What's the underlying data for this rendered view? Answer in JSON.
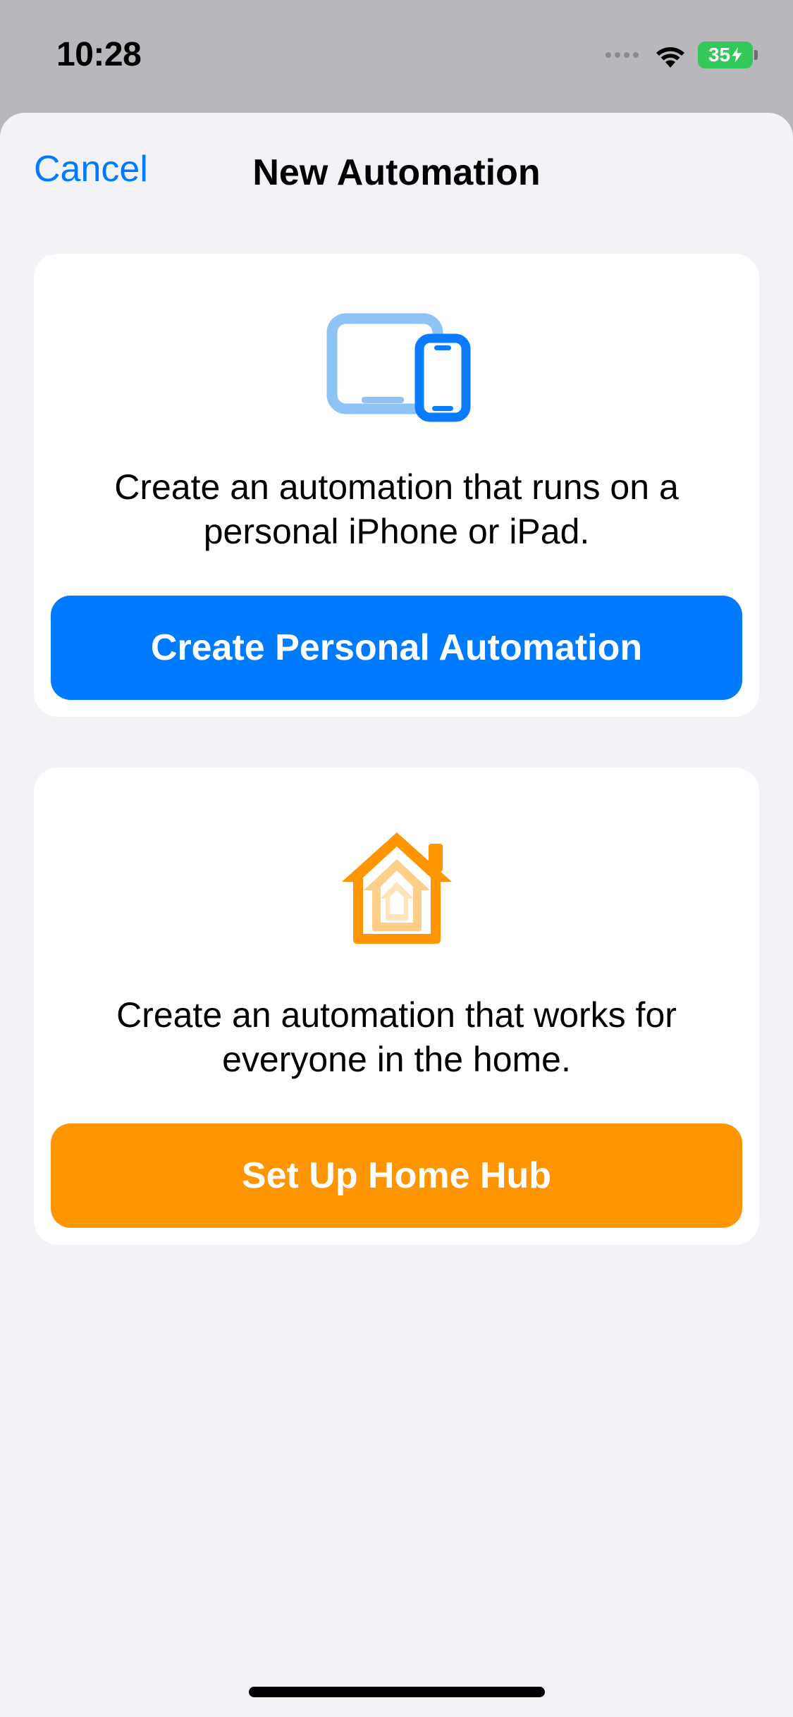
{
  "statusBar": {
    "time": "10:28",
    "batteryLabel": "35"
  },
  "nav": {
    "cancel": "Cancel",
    "title": "New Automation"
  },
  "cards": {
    "personal": {
      "description": "Create an automation that runs on a personal iPhone or iPad.",
      "button": "Create Personal Automation"
    },
    "home": {
      "description": "Create an automation that works for everyone in the home.",
      "button": "Set Up Home Hub"
    }
  }
}
